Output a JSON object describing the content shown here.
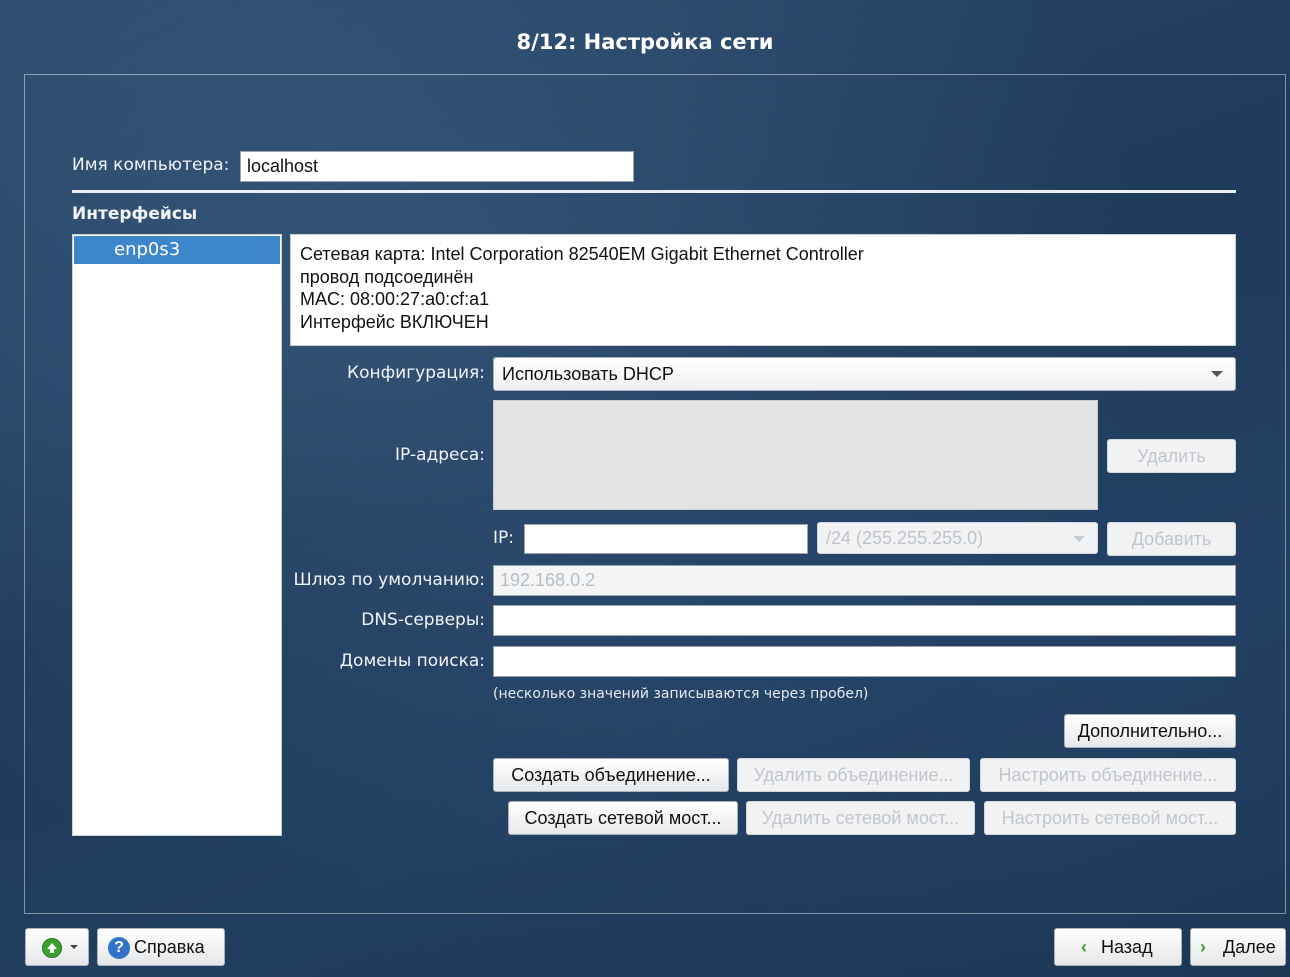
{
  "window": {
    "title": "8/12: Настройка сети"
  },
  "hostname": {
    "label": "Имя компьютера:",
    "value": "localhost"
  },
  "interfaces": {
    "heading": "Интерфейсы",
    "items": [
      {
        "label": "enp0s3",
        "selected": true
      }
    ]
  },
  "info": {
    "lines": [
      "Сетевая карта: Intel Corporation 82540EM Gigabit Ethernet Controller",
      "провод подсоединён",
      "MAC: 08:00:27:a0:cf:a1",
      "Интерфейс ВКЛЮЧЕН"
    ]
  },
  "config": {
    "label": "Конфигурация:",
    "selected": "Использовать DHCP"
  },
  "ip": {
    "list_label": "IP-адреса:",
    "remove_label": "Удалить",
    "ip_label": "IP:",
    "ip_value": "",
    "mask_value": "/24 (255.255.255.0)",
    "add_label": "Добавить"
  },
  "gateway": {
    "label": "Шлюз по умолчанию:",
    "value": "192.168.0.2"
  },
  "dns": {
    "label": "DNS-серверы:",
    "value": ""
  },
  "search_domains": {
    "label": "Домены поиска:",
    "value": ""
  },
  "hint": "(несколько значений записываются через пробел)",
  "buttons": {
    "advanced": "Дополнительно...",
    "create_bond": "Создать объединение...",
    "delete_bond": "Удалить объединение...",
    "setup_bond": "Настроить объединение...",
    "create_bridge": "Создать сетевой мост...",
    "delete_bridge": "Удалить сетевой мост...",
    "setup_bridge": "Настроить сетевой мост..."
  },
  "footer": {
    "help": "Справка",
    "back": "Назад",
    "next": "Далее"
  },
  "colors": {
    "selection": "#3d86cc",
    "help_icon": "#2f74c8",
    "next_arrow": "#3aa02e"
  }
}
